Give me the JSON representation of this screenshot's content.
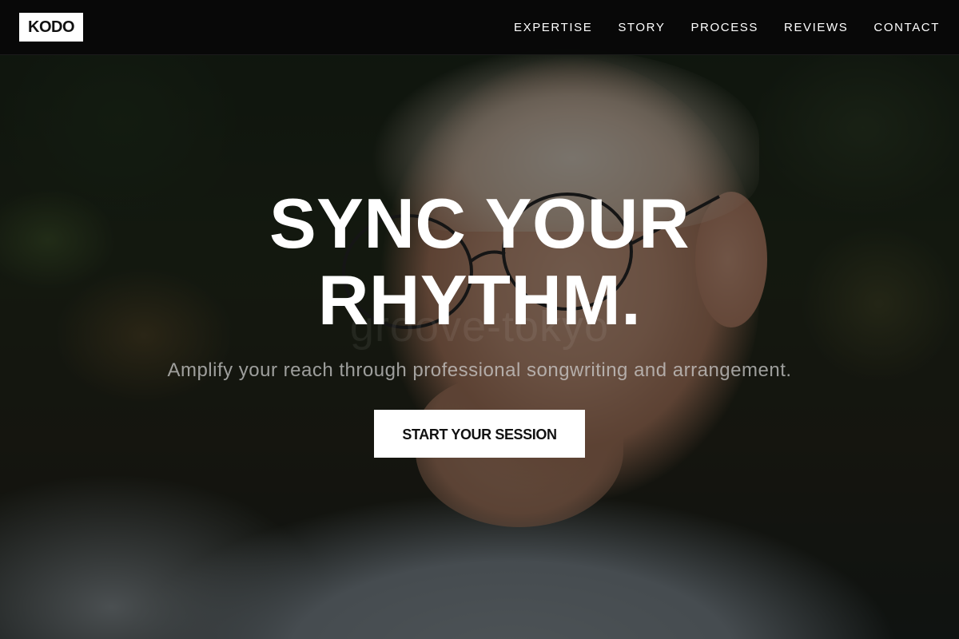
{
  "nav": {
    "logo": "KODO",
    "links": [
      {
        "label": "EXPERTISE"
      },
      {
        "label": "STORY"
      },
      {
        "label": "PROCESS"
      },
      {
        "label": "REVIEWS"
      },
      {
        "label": "CONTACT"
      }
    ]
  },
  "hero": {
    "title_line1": "SYNC YOUR",
    "title_line2": "RHYTHM.",
    "watermark": "groove-tokyo",
    "subtitle": "Amplify your reach through professional songwriting and arrangement.",
    "cta_label": "START YOUR SESSION"
  },
  "colors": {
    "nav_background": "#080808",
    "logo_background": "#ffffff",
    "cta_background": "#ffffff",
    "text_primary": "#ffffff"
  }
}
